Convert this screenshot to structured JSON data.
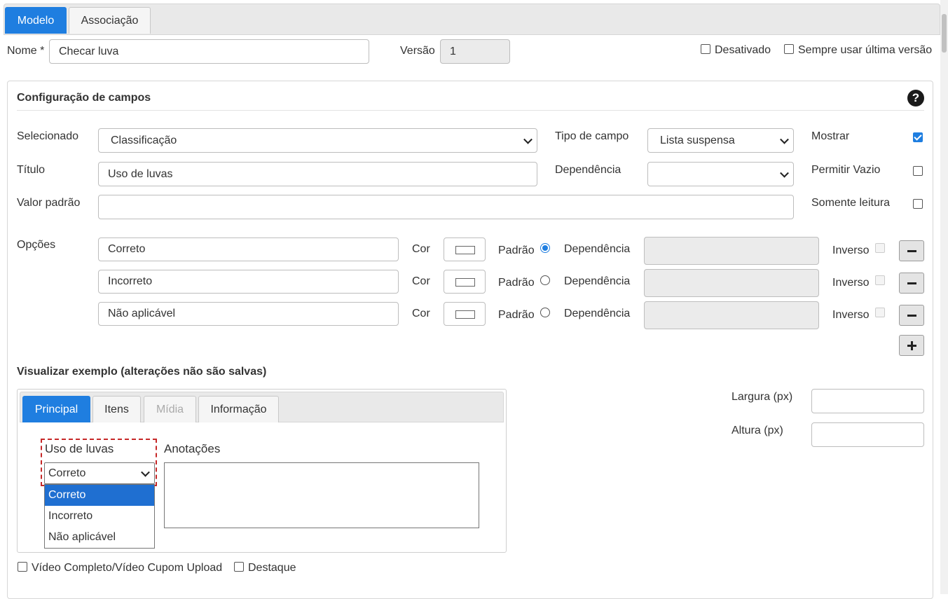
{
  "tabs": {
    "model": "Modelo",
    "association": "Associação"
  },
  "header": {
    "name_label": "Nome *",
    "name_value": "Checar luva",
    "version_label": "Versão",
    "version_value": "1",
    "disabled_label": "Desativado",
    "always_latest_label": "Sempre usar última versão"
  },
  "config": {
    "title": "Configuração de campos",
    "help_glyph": "?",
    "selected_label": "Selecionado",
    "selected_value": "Classificação",
    "field_type_label": "Tipo de campo",
    "field_type_value": "Lista suspensa",
    "show_label": "Mostrar",
    "show_checked": true,
    "title_label": "Título",
    "title_value": "Uso de luvas",
    "dependency_label": "Dependência",
    "dependency_value": "",
    "allow_empty_label": "Permitir Vazio",
    "default_value_label": "Valor padrão",
    "default_value": "",
    "readonly_label": "Somente leitura",
    "options_label": "Opções",
    "option_color_label": "Cor",
    "option_default_label": "Padrão",
    "option_dependency_label": "Dependência",
    "option_inverse_label": "Inverso",
    "options": [
      {
        "value": "Correto",
        "default": true
      },
      {
        "value": "Incorreto",
        "default": false
      },
      {
        "value": "Não aplicável",
        "default": false
      }
    ]
  },
  "preview": {
    "title": "Visualizar exemplo (alterações não são salvas)",
    "tabs": [
      "Principal",
      "Itens",
      "Mídia",
      "Informação"
    ],
    "field_label": "Uso de luvas",
    "field_value": "Correto",
    "dropdown_items": [
      "Correto",
      "Incorreto",
      "Não aplicável"
    ],
    "notes_label": "Anotações",
    "width_label": "Largura (px)",
    "height_label": "Altura (px)",
    "video_label": "Vídeo Completo/Vídeo Cupom Upload",
    "highlight_label": "Destaque"
  }
}
